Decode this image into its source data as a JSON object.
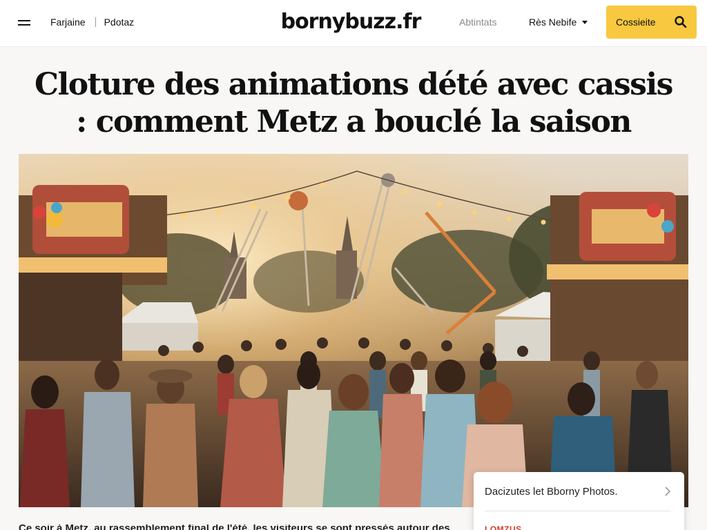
{
  "header": {
    "menu_icon": "hamburger-icon",
    "nav_left": [
      "Farjaine",
      "Pdotaz"
    ],
    "logo": "bornybuzz.fr",
    "nav_muted": "Abtintats",
    "dropdown": "Rès Nebife",
    "cta_label": "Cossieite",
    "cta_icon": "search-icon"
  },
  "article": {
    "headline": "Cloture des animations dété avec cassis : comment Metz a bouclé la saison",
    "hero_image": "photo of summer funfair crowd at sunset with rides and stalls",
    "teaser_text": "Ce soir à Metz, au rassemblement final de l'été, les visiteurs se sont pressés autour des stands"
  },
  "card": {
    "link_label": "Dacizutes let Bborny Photos.",
    "chevron_icon": "chevron-right-icon",
    "tag": "LOMZUS"
  },
  "colors": {
    "accent": "#f8c840",
    "tag": "#d33a2c",
    "background": "#f8f7f5"
  }
}
